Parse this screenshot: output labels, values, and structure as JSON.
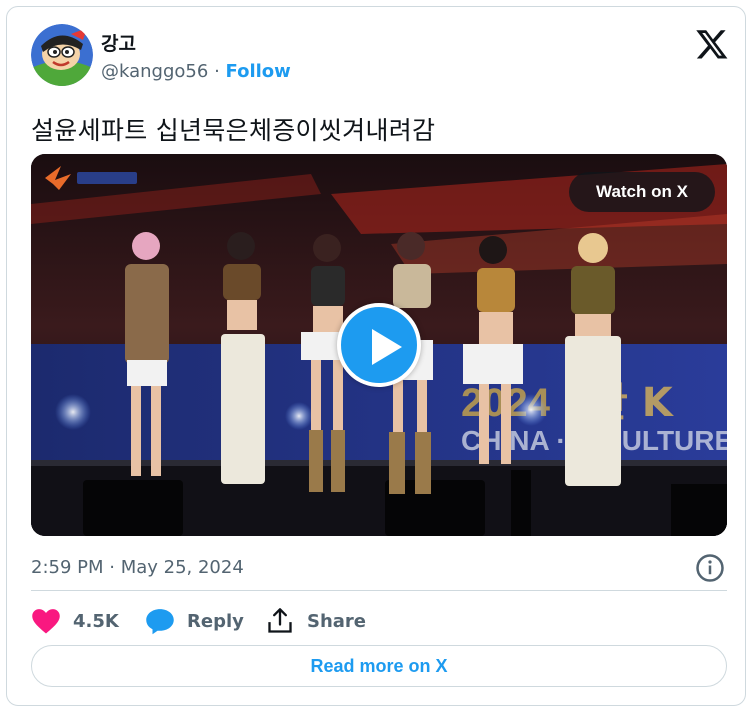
{
  "tweet": {
    "display_name": "강고",
    "handle": "@kanggo56",
    "separator": "·",
    "follow_label": "Follow",
    "text": "설윤세파트 십년묵은체증이씻겨내려감",
    "timestamp": "2:59 PM · May 25, 2024"
  },
  "media": {
    "watch_label": "Watch on X",
    "stage_banner_text": "2024 ",
    "stage_banner_text2": "한 K",
    "stage_banner_sub": "CHINA ··· -CULTURE"
  },
  "actions": {
    "like_count": "4.5K",
    "reply_label": "Reply",
    "share_label": "Share"
  },
  "footer": {
    "read_more_label": "Read more on X"
  },
  "colors": {
    "accent": "#1d9bf0",
    "like": "#f91880",
    "text_primary": "#0f1419",
    "text_secondary": "#536471",
    "border": "#cfd9de"
  },
  "icons": {
    "brand": "x-logo-icon",
    "like": "heart-icon",
    "reply": "speech-bubble-icon",
    "share": "share-upload-icon",
    "info": "info-icon",
    "play": "play-icon"
  }
}
